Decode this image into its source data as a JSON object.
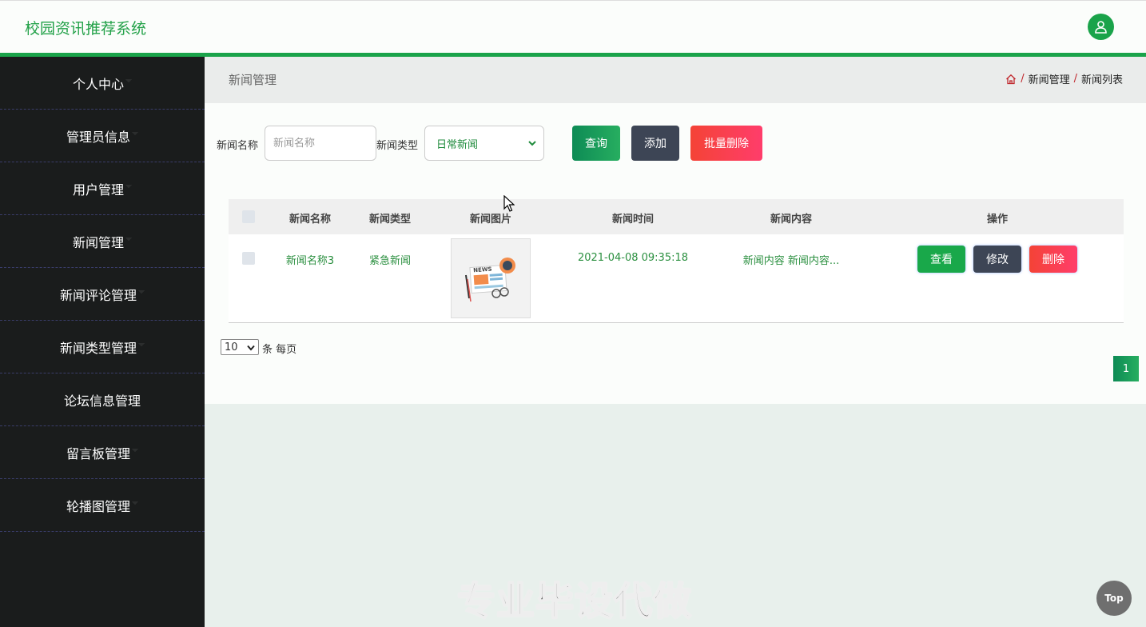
{
  "header": {
    "brand": "校园资讯推荐系统",
    "accent_color": "#1aa34a",
    "user_icon": "user-icon"
  },
  "sidebar": {
    "items": [
      {
        "label": "个人中心"
      },
      {
        "label": "管理员信息"
      },
      {
        "label": "用户管理"
      },
      {
        "label": "新闻管理"
      },
      {
        "label": "新闻评论管理"
      },
      {
        "label": "新闻类型管理"
      },
      {
        "label": "论坛信息管理"
      },
      {
        "label": "留言板管理"
      },
      {
        "label": "轮播图管理"
      }
    ]
  },
  "breadcrumb": {
    "page_title": "新闻管理",
    "home_icon": "home-icon",
    "separator": "/",
    "items": [
      "新闻管理",
      "新闻列表"
    ]
  },
  "search": {
    "name_label": "新闻名称",
    "name_placeholder": "新闻名称",
    "type_label": "新闻类型",
    "type_selected": "日常新闻",
    "query_button": "查询",
    "add_button": "添加",
    "batch_delete_button": "批量删除"
  },
  "table": {
    "columns": [
      "新闻名称",
      "新闻类型",
      "新闻图片",
      "新闻时间",
      "新闻内容",
      "操作"
    ],
    "rows": [
      {
        "name": "新闻名称3",
        "type": "紧急新闻",
        "image": "news-thumbnail",
        "time": "2021-04-08 09:35:18",
        "content": "新闻内容 新闻内容...",
        "actions": {
          "view": "查看",
          "edit": "修改",
          "delete": "删除"
        }
      }
    ]
  },
  "pagination": {
    "page_size": "10",
    "page_size_label": "条 每页",
    "current_page": "1"
  },
  "watermark": "专业毕设代做",
  "top_button": "Top"
}
